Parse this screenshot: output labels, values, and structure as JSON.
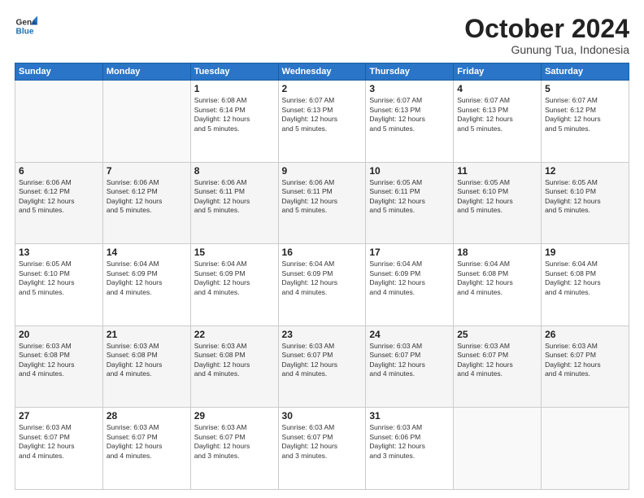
{
  "header": {
    "logo_line1": "General",
    "logo_line2": "Blue",
    "month": "October 2024",
    "location": "Gunung Tua, Indonesia"
  },
  "weekdays": [
    "Sunday",
    "Monday",
    "Tuesday",
    "Wednesday",
    "Thursday",
    "Friday",
    "Saturday"
  ],
  "weeks": [
    [
      {
        "day": "",
        "info": ""
      },
      {
        "day": "",
        "info": ""
      },
      {
        "day": "1",
        "info": "Sunrise: 6:08 AM\nSunset: 6:14 PM\nDaylight: 12 hours\nand 5 minutes."
      },
      {
        "day": "2",
        "info": "Sunrise: 6:07 AM\nSunset: 6:13 PM\nDaylight: 12 hours\nand 5 minutes."
      },
      {
        "day": "3",
        "info": "Sunrise: 6:07 AM\nSunset: 6:13 PM\nDaylight: 12 hours\nand 5 minutes."
      },
      {
        "day": "4",
        "info": "Sunrise: 6:07 AM\nSunset: 6:13 PM\nDaylight: 12 hours\nand 5 minutes."
      },
      {
        "day": "5",
        "info": "Sunrise: 6:07 AM\nSunset: 6:12 PM\nDaylight: 12 hours\nand 5 minutes."
      }
    ],
    [
      {
        "day": "6",
        "info": "Sunrise: 6:06 AM\nSunset: 6:12 PM\nDaylight: 12 hours\nand 5 minutes."
      },
      {
        "day": "7",
        "info": "Sunrise: 6:06 AM\nSunset: 6:12 PM\nDaylight: 12 hours\nand 5 minutes."
      },
      {
        "day": "8",
        "info": "Sunrise: 6:06 AM\nSunset: 6:11 PM\nDaylight: 12 hours\nand 5 minutes."
      },
      {
        "day": "9",
        "info": "Sunrise: 6:06 AM\nSunset: 6:11 PM\nDaylight: 12 hours\nand 5 minutes."
      },
      {
        "day": "10",
        "info": "Sunrise: 6:05 AM\nSunset: 6:11 PM\nDaylight: 12 hours\nand 5 minutes."
      },
      {
        "day": "11",
        "info": "Sunrise: 6:05 AM\nSunset: 6:10 PM\nDaylight: 12 hours\nand 5 minutes."
      },
      {
        "day": "12",
        "info": "Sunrise: 6:05 AM\nSunset: 6:10 PM\nDaylight: 12 hours\nand 5 minutes."
      }
    ],
    [
      {
        "day": "13",
        "info": "Sunrise: 6:05 AM\nSunset: 6:10 PM\nDaylight: 12 hours\nand 5 minutes."
      },
      {
        "day": "14",
        "info": "Sunrise: 6:04 AM\nSunset: 6:09 PM\nDaylight: 12 hours\nand 4 minutes."
      },
      {
        "day": "15",
        "info": "Sunrise: 6:04 AM\nSunset: 6:09 PM\nDaylight: 12 hours\nand 4 minutes."
      },
      {
        "day": "16",
        "info": "Sunrise: 6:04 AM\nSunset: 6:09 PM\nDaylight: 12 hours\nand 4 minutes."
      },
      {
        "day": "17",
        "info": "Sunrise: 6:04 AM\nSunset: 6:09 PM\nDaylight: 12 hours\nand 4 minutes."
      },
      {
        "day": "18",
        "info": "Sunrise: 6:04 AM\nSunset: 6:08 PM\nDaylight: 12 hours\nand 4 minutes."
      },
      {
        "day": "19",
        "info": "Sunrise: 6:04 AM\nSunset: 6:08 PM\nDaylight: 12 hours\nand 4 minutes."
      }
    ],
    [
      {
        "day": "20",
        "info": "Sunrise: 6:03 AM\nSunset: 6:08 PM\nDaylight: 12 hours\nand 4 minutes."
      },
      {
        "day": "21",
        "info": "Sunrise: 6:03 AM\nSunset: 6:08 PM\nDaylight: 12 hours\nand 4 minutes."
      },
      {
        "day": "22",
        "info": "Sunrise: 6:03 AM\nSunset: 6:08 PM\nDaylight: 12 hours\nand 4 minutes."
      },
      {
        "day": "23",
        "info": "Sunrise: 6:03 AM\nSunset: 6:07 PM\nDaylight: 12 hours\nand 4 minutes."
      },
      {
        "day": "24",
        "info": "Sunrise: 6:03 AM\nSunset: 6:07 PM\nDaylight: 12 hours\nand 4 minutes."
      },
      {
        "day": "25",
        "info": "Sunrise: 6:03 AM\nSunset: 6:07 PM\nDaylight: 12 hours\nand 4 minutes."
      },
      {
        "day": "26",
        "info": "Sunrise: 6:03 AM\nSunset: 6:07 PM\nDaylight: 12 hours\nand 4 minutes."
      }
    ],
    [
      {
        "day": "27",
        "info": "Sunrise: 6:03 AM\nSunset: 6:07 PM\nDaylight: 12 hours\nand 4 minutes."
      },
      {
        "day": "28",
        "info": "Sunrise: 6:03 AM\nSunset: 6:07 PM\nDaylight: 12 hours\nand 4 minutes."
      },
      {
        "day": "29",
        "info": "Sunrise: 6:03 AM\nSunset: 6:07 PM\nDaylight: 12 hours\nand 3 minutes."
      },
      {
        "day": "30",
        "info": "Sunrise: 6:03 AM\nSunset: 6:07 PM\nDaylight: 12 hours\nand 3 minutes."
      },
      {
        "day": "31",
        "info": "Sunrise: 6:03 AM\nSunset: 6:06 PM\nDaylight: 12 hours\nand 3 minutes."
      },
      {
        "day": "",
        "info": ""
      },
      {
        "day": "",
        "info": ""
      }
    ]
  ]
}
